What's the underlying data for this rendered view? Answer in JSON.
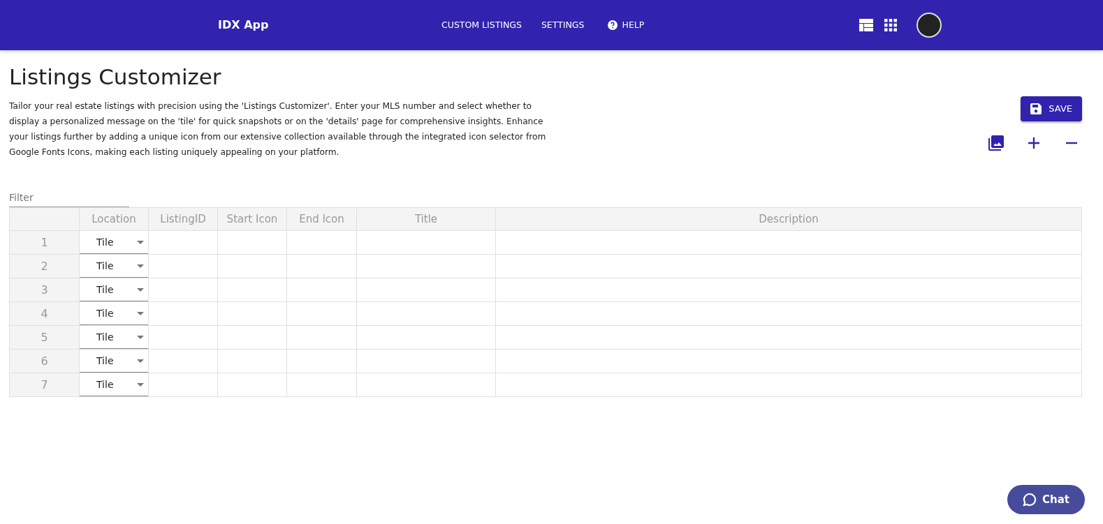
{
  "navbar": {
    "brand": "IDX App",
    "links": [
      {
        "label": "CUSTOM LISTINGS",
        "kind": "text"
      },
      {
        "label": "SETTINGS",
        "kind": "text"
      },
      {
        "label": "HELP",
        "kind": "help"
      }
    ]
  },
  "page": {
    "title": "Listings Customizer",
    "description": "Tailor your real estate listings with precision using the 'Listings Customizer'. Enter your MLS number and select whether to display a personalized message on the 'tile' for quick snapshots or on the 'details' page for comprehensive insights. Enhance your listings further by adding a unique icon from our extensive collection available through the integrated icon selector from Google Fonts Icons, making each listing uniquely appealing on your platform.",
    "save_button": "SAVE"
  },
  "filter": {
    "placeholder": "Filter"
  },
  "table": {
    "columns": [
      "Location",
      "ListingID",
      "Start Icon",
      "End Icon",
      "Title",
      "Description"
    ],
    "rows": [
      {
        "number": "1",
        "location": "Tile"
      },
      {
        "number": "2",
        "location": "Tile"
      },
      {
        "number": "3",
        "location": "Tile"
      },
      {
        "number": "4",
        "location": "Tile"
      },
      {
        "number": "5",
        "location": "Tile"
      },
      {
        "number": "6",
        "location": "Tile"
      },
      {
        "number": "7",
        "location": "Tile"
      }
    ]
  },
  "chat_button": "Chat"
}
